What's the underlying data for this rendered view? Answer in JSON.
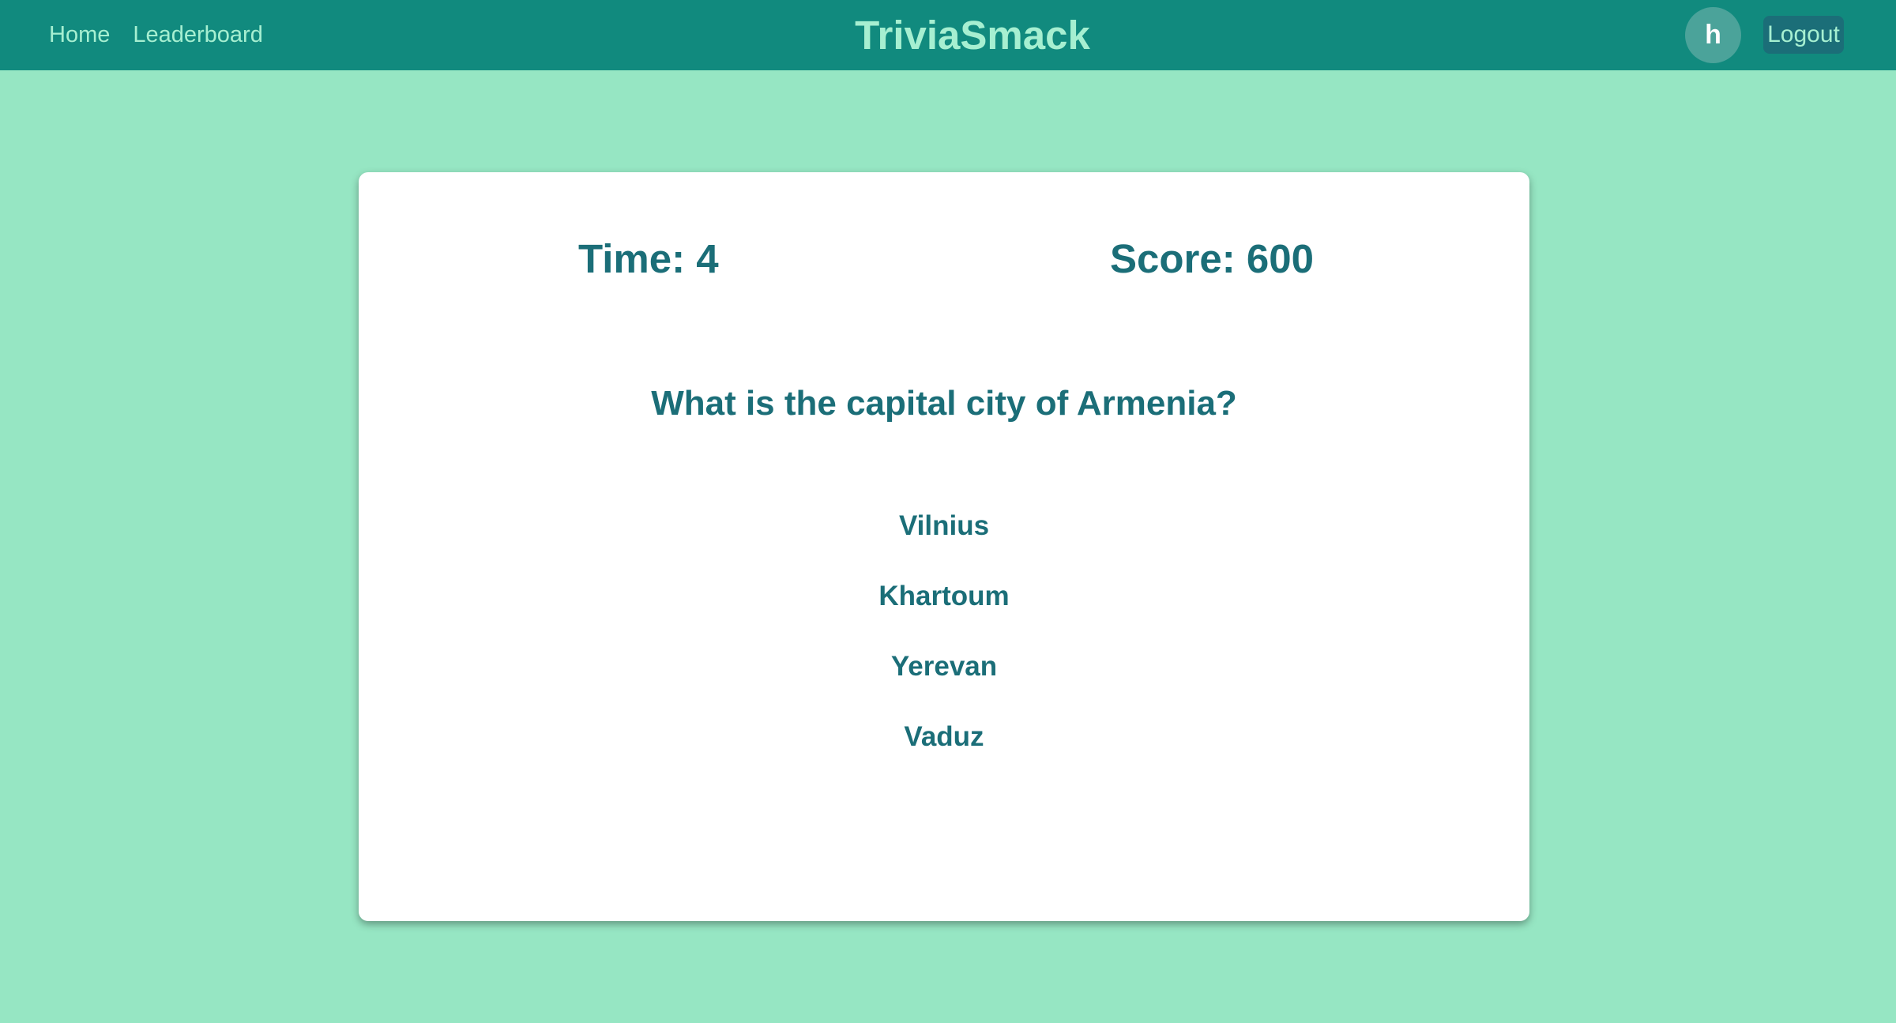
{
  "nav": {
    "links": [
      "Home",
      "Leaderboard"
    ],
    "brand": "TriviaSmack",
    "avatar_initial": "h",
    "logout_label": "Logout"
  },
  "game": {
    "time_text": "Time: 4",
    "score_text": "Score: 600",
    "question": "What is the capital city of Armenia?",
    "answers": [
      "Vilnius",
      "Khartoum",
      "Yerevan",
      "Vaduz"
    ]
  },
  "colors": {
    "page_background": "#96e6c3",
    "navbar": "#118a7e",
    "nav_text": "#a6efd1",
    "text_primary": "#1b6e78",
    "card": "#ffffff"
  }
}
